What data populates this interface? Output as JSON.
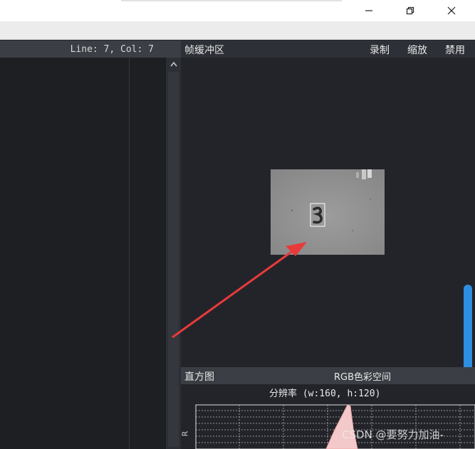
{
  "window": {
    "controls": [
      "minimize",
      "maximize",
      "close"
    ]
  },
  "editor": {
    "status": "Line: 7, Col: 7"
  },
  "frame_buffer": {
    "title": "帧缓冲区",
    "actions": {
      "record": "录制",
      "zoom": "缩放",
      "disable": "禁用"
    }
  },
  "histogram": {
    "title": "直方图",
    "color_space": "RGB色彩空间",
    "resolution": "分辨率 (w:160, h:120)",
    "channel_label": "R"
  },
  "watermark": "CSDN @要努力加油-",
  "colors": {
    "accent_scroll": "#2e8ee0",
    "annotation_arrow": "#e83a3a"
  }
}
